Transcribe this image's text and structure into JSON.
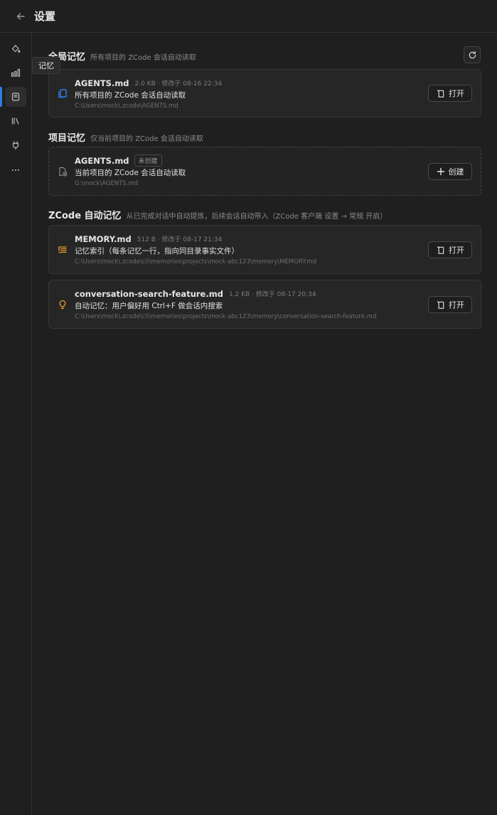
{
  "header": {
    "title": "设置",
    "back_icon": "arrow-left-icon"
  },
  "sidebar": {
    "items": [
      {
        "icon": "paint-bucket-icon"
      },
      {
        "icon": "bar-chart-icon"
      },
      {
        "icon": "memory-icon",
        "active": true
      },
      {
        "icon": "library-icon"
      },
      {
        "icon": "plug-icon"
      },
      {
        "icon": "more-icon"
      }
    ],
    "tooltip": "记忆"
  },
  "global": {
    "title": "全局记忆",
    "desc": "所有项目的 ZCode 会话自动读取",
    "card": {
      "name": "AGENTS.md",
      "meta": "2.0 KB · 修改于 08-16 22:34",
      "desc": "所有项目的 ZCode 会话自动读取",
      "path": "C:\\Users\\mock\\.zcode\\AGENTS.md",
      "button": "打开"
    }
  },
  "project": {
    "title": "项目记忆",
    "desc": "仅当前项目的 ZCode 会话自动读取",
    "card": {
      "name": "AGENTS.md",
      "badge": "未创建",
      "desc": "当前项目的 ZCode 会话自动读取",
      "path": "G:\\mock\\AGENTS.md",
      "button": "创建"
    }
  },
  "auto": {
    "title": "ZCode 自动记忆",
    "desc": "从已完成对话中自动提炼，后续会话自动带入（ZCode 客户端 设置 → 常规 开启）",
    "cards": [
      {
        "name": "MEMORY.md",
        "meta": "512 B · 修改于 08-17 21:34",
        "desc": "记忆索引（每条记忆一行，指向同目录事实文件）",
        "path": "C:\\Users\\mock\\.zcode\\cli\\memories\\projects\\mock-abc123\\memory\\MEMORY.md",
        "button": "打开",
        "icon": "list-index-icon"
      },
      {
        "name": "conversation-search-feature.md",
        "meta": "1.2 KB · 修改于 08-17 20:34",
        "desc": "自动记忆：用户偏好用 Ctrl+F 做会话内搜索",
        "path": "C:\\Users\\mock\\.zcode\\cli\\memories\\projects\\mock-abc123\\memory\\conversation-search-feature.md",
        "button": "打开",
        "icon": "lightbulb-icon"
      }
    ]
  },
  "colors": {
    "accent": "#2f7de1",
    "orange": "#e59a2c",
    "background": "#1f1f1f",
    "card": "#262626"
  }
}
